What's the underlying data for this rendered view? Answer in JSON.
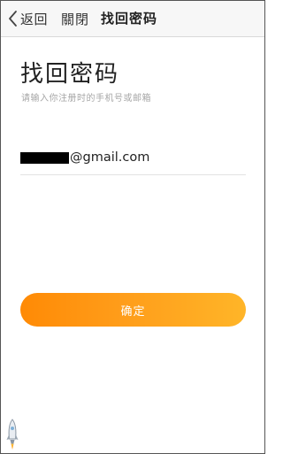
{
  "navbar": {
    "back_label": "返回",
    "close_label": "關閉",
    "title": "找回密码"
  },
  "main": {
    "title": "找回密码",
    "subtitle": "请输入你注册时的手机号或邮箱",
    "email_domain": "@gmail.com",
    "confirm_label": "确定"
  },
  "icons": {
    "back": "chevron-left-icon",
    "floating": "rocket-icon"
  },
  "colors": {
    "button_gradient_start": "#ff8a05",
    "button_gradient_end": "#ffb528",
    "text_primary": "#222222",
    "text_secondary": "#a6a6a6",
    "navbar_background": "#f7f7f7"
  }
}
